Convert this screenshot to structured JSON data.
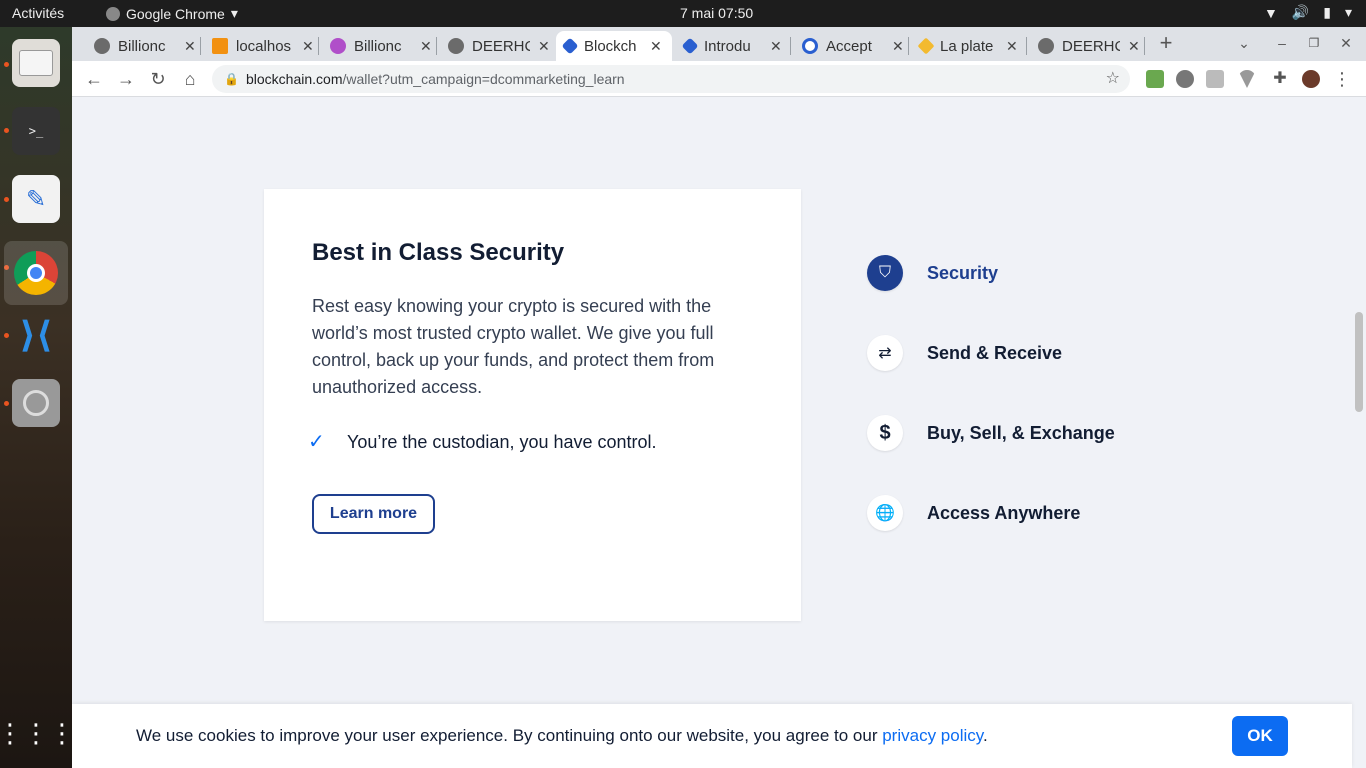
{
  "os": {
    "activities": "Activités",
    "app_name": "Google Chrome",
    "clock": "7 mai  07:50"
  },
  "tabs": [
    {
      "title": "Billionc",
      "icon": "globe-icon",
      "active": false
    },
    {
      "title": "localhos",
      "icon": "phpmyadmin-icon",
      "active": false
    },
    {
      "title": "Billionc",
      "icon": "billioncoin-icon",
      "active": false
    },
    {
      "title": "DEERHC",
      "icon": "globe-icon",
      "active": false
    },
    {
      "title": "Blockch",
      "icon": "blockchain-icon",
      "active": true
    },
    {
      "title": "Introdu",
      "icon": "blockchain-icon",
      "active": false
    },
    {
      "title": "Accept",
      "icon": "coinpayments-icon",
      "active": false
    },
    {
      "title": "La plate",
      "icon": "binance-icon",
      "active": false
    },
    {
      "title": "DEERHC",
      "icon": "globe-icon",
      "active": false
    }
  ],
  "address_bar": {
    "host": "blockchain.com",
    "path": "/wallet?utm_campaign=dcommarketing_learn"
  },
  "card": {
    "title": "Best in Class Security",
    "body": "Rest easy knowing your crypto is secured with the world’s most trusted crypto wallet. We give you full control, back up your funds, and protect them from unauthorized access.",
    "bullet": "You’re the custodian, you have control.",
    "learn_more": "Learn more"
  },
  "features": [
    {
      "label": "Security",
      "icon": "shield-icon",
      "active": true
    },
    {
      "label": "Send & Receive",
      "icon": "swap-arrows-icon",
      "active": false
    },
    {
      "label": "Buy, Sell, & Exchange",
      "icon": "dollar-icon",
      "active": false
    },
    {
      "label": "Access Anywhere",
      "icon": "globe-icon",
      "active": false
    }
  ],
  "cookie": {
    "text": "We use cookies to improve your user experience. By continuing onto our website, you agree to our ",
    "link": "privacy policy",
    "suffix": ".",
    "ok": "OK"
  },
  "colors": {
    "brand_blue": "#1e3f8f",
    "link_blue": "#0c6cf2",
    "page_bg": "#f0f2f7"
  }
}
